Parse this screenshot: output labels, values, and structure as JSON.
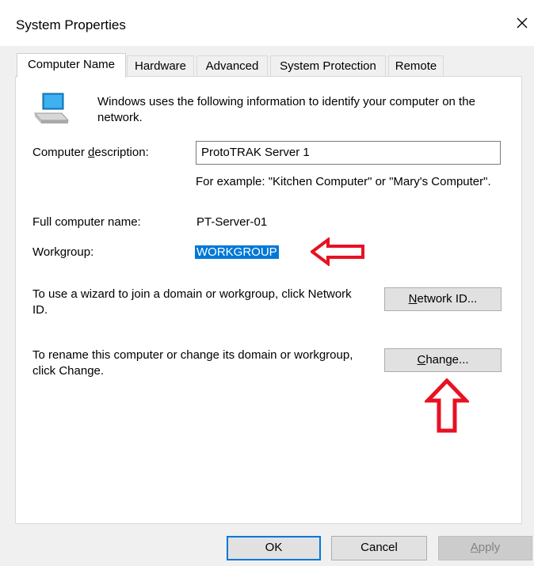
{
  "window": {
    "title": "System Properties"
  },
  "tabs": [
    {
      "label": "Computer Name",
      "active": true
    },
    {
      "label": "Hardware"
    },
    {
      "label": "Advanced"
    },
    {
      "label": "System Protection"
    },
    {
      "label": "Remote"
    }
  ],
  "computer_name": {
    "intro": "Windows uses the following information to identify your computer on the network.",
    "description_label_pre": "Computer ",
    "description_label_accel": "d",
    "description_label_post": "escription:",
    "description_value": "ProtoTRAK Server 1",
    "example_text": "For example: \"Kitchen Computer\" or \"Mary's Computer\".",
    "full_name_label": "Full computer name:",
    "full_name_value": "PT-Server-01",
    "workgroup_label": "Workgroup:",
    "workgroup_value": "WORKGROUP",
    "network_id_text": "To use a wizard to join a domain or workgroup, click Network ID.",
    "network_id_button": {
      "accel": "N",
      "rest": "etwork ID..."
    },
    "change_text": "To rename this computer or change its domain or workgroup, click Change.",
    "change_button": {
      "accel": "C",
      "rest": "hange..."
    }
  },
  "footer": {
    "ok": "OK",
    "cancel": "Cancel",
    "apply": {
      "accel": "A",
      "rest": "pply"
    }
  },
  "annotation_color": "#e81123",
  "icons": [
    "computer-icon",
    "close-icon",
    "red-arrow-left-icon",
    "red-arrow-up-icon"
  ]
}
